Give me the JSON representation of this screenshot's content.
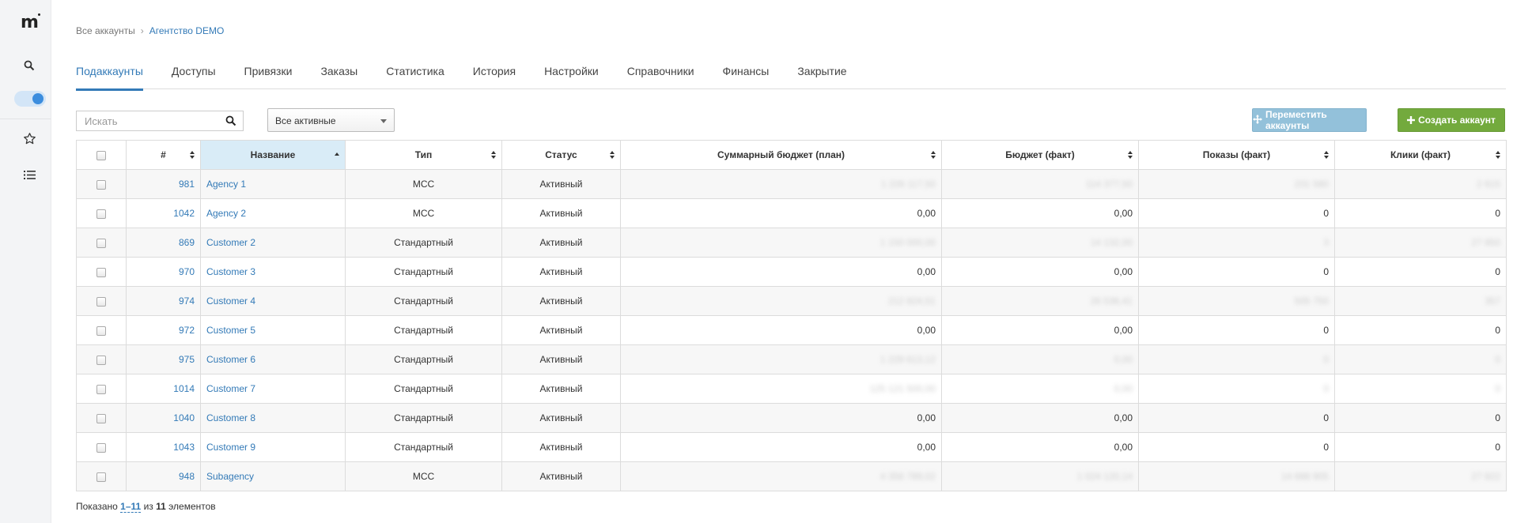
{
  "sidebar": {
    "logo": "m",
    "icons": [
      "search-icon",
      "toggle-switch",
      "star-icon",
      "list-icon"
    ],
    "toggle_on": true
  },
  "breadcrumb": {
    "root": "Все аккаунты",
    "separator": "›",
    "current": "Агентство DEMO"
  },
  "tabs": [
    {
      "label": "Подаккаунты",
      "active": true
    },
    {
      "label": "Доступы"
    },
    {
      "label": "Привязки"
    },
    {
      "label": "Заказы"
    },
    {
      "label": "Статистика"
    },
    {
      "label": "История"
    },
    {
      "label": "Настройки"
    },
    {
      "label": "Справочники"
    },
    {
      "label": "Финансы"
    },
    {
      "label": "Закрытие"
    }
  ],
  "search": {
    "placeholder": "Искать",
    "value": ""
  },
  "filter": {
    "selected": "Все активные"
  },
  "buttons": {
    "move_label": "Переместить аккаунты",
    "create_label": "Создать аккаунт"
  },
  "colors": {
    "accent": "#337ab7",
    "move_button": "#93c1da",
    "create_button": "#73aa3d",
    "sorted_header": "#d9ecf7"
  },
  "table": {
    "columns": {
      "id": "#",
      "name": "Название",
      "type": "Тип",
      "status": "Статус",
      "budget_plan": "Суммарный бюджет (план)",
      "budget_fact": "Бюджет (факт)",
      "impressions": "Показы (факт)",
      "clicks": "Клики (факт)"
    },
    "rows": [
      {
        "id": "981",
        "name": "Agency 1",
        "type": "MCC",
        "status": "Активный",
        "budget_plan": "1 226 117,50",
        "budget_fact": "114 377,50",
        "impressions": "231 580",
        "clicks": "2 615"
      },
      {
        "id": "1042",
        "name": "Agency 2",
        "type": "MCC",
        "status": "Активный",
        "budget_plan": "0,00",
        "budget_fact": "0,00",
        "impressions": "0",
        "clicks": "0"
      },
      {
        "id": "869",
        "name": "Customer 2",
        "type": "Стандартный",
        "status": "Активный",
        "budget_plan": "1 150 000,00",
        "budget_fact": "14 132,00",
        "impressions": "3",
        "clicks": "27 850"
      },
      {
        "id": "970",
        "name": "Customer 3",
        "type": "Стандартный",
        "status": "Активный",
        "budget_plan": "0,00",
        "budget_fact": "0,00",
        "impressions": "0",
        "clicks": "0"
      },
      {
        "id": "974",
        "name": "Customer 4",
        "type": "Стандартный",
        "status": "Активный",
        "budget_plan": "212 824,51",
        "budget_fact": "26 536,41",
        "impressions": "505 750",
        "clicks": "357"
      },
      {
        "id": "972",
        "name": "Customer 5",
        "type": "Стандартный",
        "status": "Активный",
        "budget_plan": "0,00",
        "budget_fact": "0,00",
        "impressions": "0",
        "clicks": "0"
      },
      {
        "id": "975",
        "name": "Customer 6",
        "type": "Стандартный",
        "status": "Активный",
        "budget_plan": "1 229 613,12",
        "budget_fact": "0,00",
        "impressions": "0",
        "clicks": "0"
      },
      {
        "id": "1014",
        "name": "Customer 7",
        "type": "Стандартный",
        "status": "Активный",
        "budget_plan": "125 121 500,00",
        "budget_fact": "0,00",
        "impressions": "0",
        "clicks": "0"
      },
      {
        "id": "1040",
        "name": "Customer 8",
        "type": "Стандартный",
        "status": "Активный",
        "budget_plan": "0,00",
        "budget_fact": "0,00",
        "impressions": "0",
        "clicks": "0"
      },
      {
        "id": "1043",
        "name": "Customer 9",
        "type": "Стандартный",
        "status": "Активный",
        "budget_plan": "0,00",
        "budget_fact": "0,00",
        "impressions": "0",
        "clicks": "0"
      },
      {
        "id": "948",
        "name": "Subagency",
        "type": "MCC",
        "status": "Активный",
        "budget_plan": "4 356 789,02",
        "budget_fact": "1 024 120,14",
        "impressions": "14 688 905",
        "clicks": "27 822"
      }
    ]
  },
  "summary": {
    "prefix": "Показано",
    "range": "1–11",
    "of": "из",
    "total": "11",
    "suffix": "элементов"
  }
}
